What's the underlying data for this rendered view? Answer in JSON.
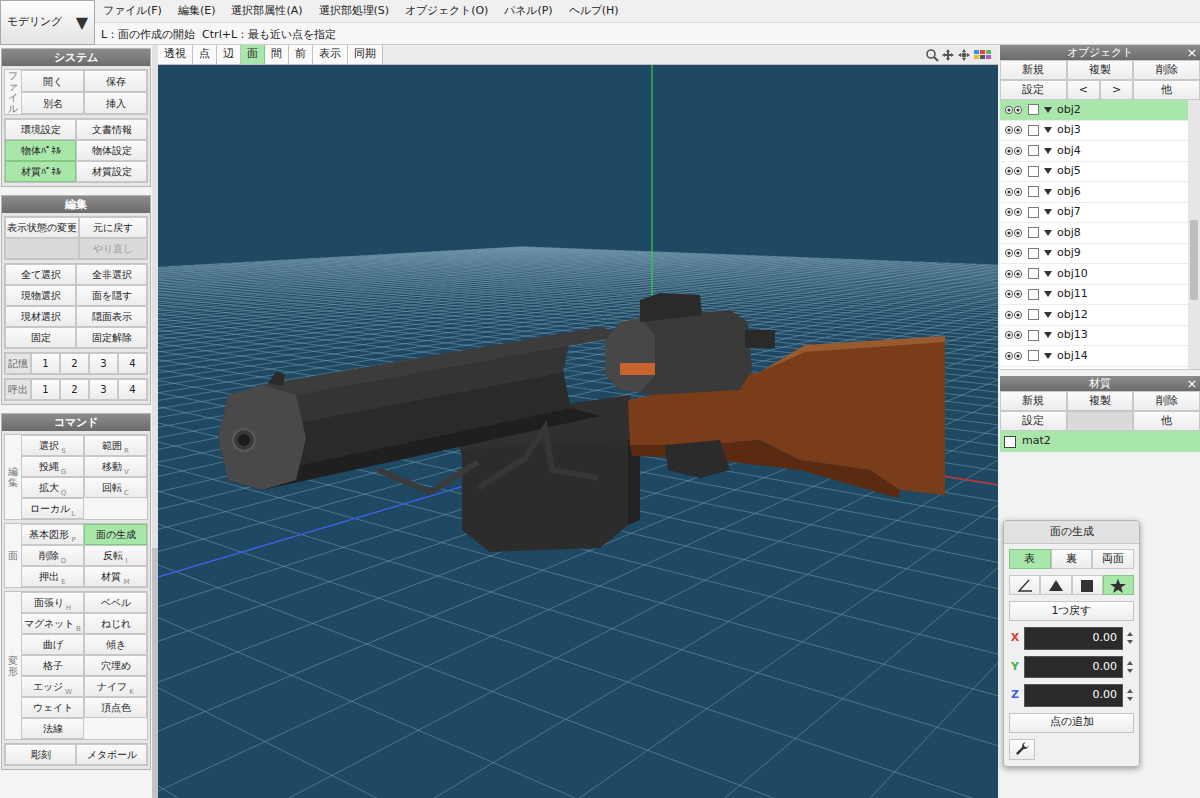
{
  "mode_selector": {
    "label": "モデリング",
    "arrow": "▼"
  },
  "menu": [
    "ファイル(F)",
    "編集(E)",
    "選択部属性(A)",
    "選択部処理(S)",
    "オブジェクト(O)",
    "パネル(P)",
    "ヘルプ(H)"
  ],
  "hint": "L：面の作成の開始  Ctrl+L：最も近い点を指定",
  "left_panel": {
    "sections": [
      {
        "title": "システム",
        "groups": [
          {
            "kind": "stack",
            "label": "ファイル",
            "rows": [
              [
                {
                  "label": "開く",
                  "selected": false,
                  "disabled": false
                },
                {
                  "label": "保存",
                  "selected": false,
                  "disabled": false
                }
              ],
              [
                {
                  "label": "別名",
                  "selected": false,
                  "disabled": false
                },
                {
                  "label": "挿入",
                  "selected": false,
                  "disabled": false
                }
              ]
            ]
          },
          {
            "kind": "plain",
            "rows": [
              [
                {
                  "label": "環境設定",
                  "selected": false,
                  "disabled": false
                },
                {
                  "label": "文書情報",
                  "selected": false,
                  "disabled": false
                }
              ],
              [
                {
                  "label": "物体ﾊﾟﾈﾙ",
                  "selected": true,
                  "disabled": false
                },
                {
                  "label": "物体設定",
                  "selected": false,
                  "disabled": false
                }
              ],
              [
                {
                  "label": "材質ﾊﾟﾈﾙ",
                  "selected": true,
                  "disabled": false
                },
                {
                  "label": "材質設定",
                  "selected": false,
                  "disabled": false
                }
              ]
            ]
          }
        ]
      },
      {
        "title": "編集",
        "groups": [
          {
            "kind": "plain",
            "rows": [
              [
                {
                  "label": "表示状態の変更",
                  "selected": false,
                  "disabled": false
                },
                {
                  "label": "元に戻す",
                  "selected": false,
                  "disabled": false
                }
              ],
              [
                {
                  "label": "",
                  "selected": false,
                  "disabled": true
                },
                {
                  "label": "やり直し",
                  "selected": false,
                  "disabled": true
                }
              ]
            ]
          },
          {
            "kind": "plain",
            "rows": [
              [
                {
                  "label": "全て選択",
                  "selected": false,
                  "disabled": false
                },
                {
                  "label": "全非選択",
                  "selected": false,
                  "disabled": false
                }
              ],
              [
                {
                  "label": "現物選択",
                  "selected": false,
                  "disabled": false
                },
                {
                  "label": "面を隠す",
                  "selected": false,
                  "disabled": false
                }
              ],
              [
                {
                  "label": "現材選択",
                  "selected": false,
                  "disabled": false
                },
                {
                  "label": "隠面表示",
                  "selected": false,
                  "disabled": false
                }
              ],
              [
                {
                  "label": "固定",
                  "selected": false,
                  "disabled": false
                },
                {
                  "label": "固定解除",
                  "selected": false,
                  "disabled": false
                }
              ]
            ]
          },
          {
            "kind": "inline",
            "label": "記憶",
            "rows": [
              [
                {
                  "label": "1",
                  "selected": false,
                  "disabled": false
                },
                {
                  "label": "2",
                  "selected": false,
                  "disabled": false
                },
                {
                  "label": "3",
                  "selected": false,
                  "disabled": false
                },
                {
                  "label": "4",
                  "selected": false,
                  "disabled": false
                }
              ]
            ]
          },
          {
            "kind": "inline",
            "label": "呼出",
            "rows": [
              [
                {
                  "label": "1",
                  "selected": false,
                  "disabled": false
                },
                {
                  "label": "2",
                  "selected": false,
                  "disabled": false
                },
                {
                  "label": "3",
                  "selected": false,
                  "disabled": false
                },
                {
                  "label": "4",
                  "selected": false,
                  "disabled": false
                }
              ]
            ]
          }
        ]
      },
      {
        "title": "コマンド",
        "groups": [
          {
            "kind": "stack",
            "label": "編集",
            "rows": [
              [
                {
                  "label": "選択",
                  "key": "S",
                  "selected": false,
                  "disabled": false
                },
                {
                  "label": "範囲",
                  "key": "R",
                  "selected": false,
                  "disabled": false
                }
              ],
              [
                {
                  "label": "投縄",
                  "key": "G",
                  "selected": false,
                  "disabled": false
                },
                {
                  "label": "移動",
                  "key": "V",
                  "selected": false,
                  "disabled": false
                }
              ],
              [
                {
                  "label": "拡大",
                  "key": "Q",
                  "selected": false,
                  "disabled": false
                },
                {
                  "label": "回転",
                  "key": "C",
                  "selected": false,
                  "disabled": false
                }
              ],
              [
                {
                  "label": "ローカル",
                  "key": "L",
                  "selected": false,
                  "disabled": false
                }
              ]
            ]
          },
          {
            "kind": "stack",
            "label": "面",
            "rows": [
              [
                {
                  "label": "基本図形",
                  "key": "P",
                  "selected": false,
                  "disabled": false
                },
                {
                  "label": "面の生成",
                  "selected": true,
                  "disabled": false
                }
              ],
              [
                {
                  "label": "削除",
                  "key": "D",
                  "selected": false,
                  "disabled": false
                },
                {
                  "label": "反転",
                  "key": "I",
                  "selected": false,
                  "disabled": false
                }
              ],
              [
                {
                  "label": "押出",
                  "key": "E",
                  "selected": false,
                  "disabled": false
                },
                {
                  "label": "材質",
                  "key": "M",
                  "selected": false,
                  "disabled": false
                }
              ]
            ]
          },
          {
            "kind": "stack",
            "label": "変形",
            "rows": [
              [
                {
                  "label": "面張り",
                  "key": "H",
                  "selected": false,
                  "disabled": false
                },
                {
                  "label": "ベベル",
                  "selected": false,
                  "disabled": false
                }
              ],
              [
                {
                  "label": "マグネット",
                  "key": "B",
                  "selected": false,
                  "disabled": false
                },
                {
                  "label": "ねじれ",
                  "selected": false,
                  "disabled": false
                }
              ],
              [
                {
                  "label": "曲げ",
                  "selected": false,
                  "disabled": false
                },
                {
                  "label": "傾き",
                  "selected": false,
                  "disabled": false
                }
              ],
              [
                {
                  "label": "格子",
                  "selected": false,
                  "disabled": false
                },
                {
                  "label": "穴埋め",
                  "selected": false,
                  "disabled": false
                }
              ],
              [
                {
                  "label": "エッジ",
                  "key": "W",
                  "selected": false,
                  "disabled": false
                },
                {
                  "label": "ナイフ",
                  "key": "K",
                  "selected": false,
                  "disabled": false
                }
              ],
              [
                {
                  "label": "ウェイト",
                  "selected": false,
                  "disabled": false
                },
                {
                  "label": "頂点色",
                  "selected": false,
                  "disabled": false
                }
              ],
              [
                {
                  "label": "法線",
                  "selected": false,
                  "disabled": false
                }
              ]
            ]
          },
          {
            "kind": "plain",
            "rows": [
              [
                {
                  "label": "彫刻",
                  "selected": false,
                  "disabled": false
                },
                {
                  "label": "メタボール",
                  "selected": false,
                  "disabled": false
                }
              ]
            ]
          }
        ]
      }
    ]
  },
  "viewport": {
    "toolbar": [
      {
        "label": "透視",
        "selected": false
      },
      {
        "label": "点",
        "selected": false
      },
      {
        "label": "辺",
        "selected": false
      },
      {
        "label": "面",
        "selected": true
      },
      {
        "label": "間",
        "selected": false
      },
      {
        "label": "前",
        "selected": false
      },
      {
        "label": "表示",
        "selected": false
      },
      {
        "label": "同期",
        "selected": false
      }
    ]
  },
  "object_panel": {
    "title": "オブジェクト",
    "close": "×",
    "button_rows": [
      [
        {
          "label": "新規",
          "disabled": false
        },
        {
          "label": "複製",
          "disabled": false
        },
        {
          "label": "削除",
          "disabled": false
        }
      ],
      [
        {
          "label": "設定",
          "disabled": false
        },
        {
          "label": "<",
          "disabled": false
        },
        {
          "label": ">",
          "disabled": false
        },
        {
          "label": "他",
          "disabled": false
        }
      ]
    ],
    "items": [
      {
        "name": "obj2",
        "visible": true,
        "locked": false,
        "expanded": true,
        "selected": true
      },
      {
        "name": "obj3",
        "visible": true,
        "locked": false,
        "expanded": true,
        "selected": false
      },
      {
        "name": "obj4",
        "visible": true,
        "locked": false,
        "expanded": true,
        "selected": false
      },
      {
        "name": "obj5",
        "visible": true,
        "locked": false,
        "expanded": true,
        "selected": false
      },
      {
        "name": "obj6",
        "visible": true,
        "locked": false,
        "expanded": true,
        "selected": false
      },
      {
        "name": "obj7",
        "visible": true,
        "locked": false,
        "expanded": true,
        "selected": false
      },
      {
        "name": "obj8",
        "visible": true,
        "locked": false,
        "expanded": true,
        "selected": false
      },
      {
        "name": "obj9",
        "visible": true,
        "locked": false,
        "expanded": true,
        "selected": false
      },
      {
        "name": "obj10",
        "visible": true,
        "locked": false,
        "expanded": true,
        "selected": false
      },
      {
        "name": "obj11",
        "visible": true,
        "locked": false,
        "expanded": true,
        "selected": false
      },
      {
        "name": "obj12",
        "visible": true,
        "locked": false,
        "expanded": true,
        "selected": false
      },
      {
        "name": "obj13",
        "visible": true,
        "locked": false,
        "expanded": true,
        "selected": false
      },
      {
        "name": "obj14",
        "visible": true,
        "locked": false,
        "expanded": true,
        "selected": false
      }
    ]
  },
  "material_panel": {
    "title": "材質",
    "close": "×",
    "button_rows": [
      [
        {
          "label": "新規",
          "disabled": false
        },
        {
          "label": "複製",
          "disabled": false
        },
        {
          "label": "削除",
          "disabled": false
        }
      ],
      [
        {
          "label": "設定",
          "disabled": false
        },
        {
          "label": "",
          "disabled": true
        },
        {
          "label": "他",
          "disabled": false
        }
      ]
    ],
    "items": [
      {
        "name": "mat2",
        "color": "#ffffff",
        "selected": true
      }
    ]
  },
  "face_panel": {
    "title": "面の生成",
    "sides": [
      {
        "label": "表",
        "selected": true
      },
      {
        "label": "裏",
        "selected": false
      },
      {
        "label": "両面",
        "selected": false
      }
    ],
    "modes": [
      {
        "kind": "angle",
        "selected": false
      },
      {
        "kind": "triangle",
        "selected": false
      },
      {
        "kind": "square",
        "selected": false
      },
      {
        "kind": "star",
        "selected": true
      }
    ],
    "undo": "1つ戻す",
    "coords": [
      {
        "axis": "X",
        "value": "0.00",
        "color": "#e03c3c"
      },
      {
        "axis": "Y",
        "value": "0.00",
        "color": "#3cb44b"
      },
      {
        "axis": "Z",
        "value": "0.00",
        "color": "#3c64dc"
      }
    ],
    "add_point": "点の追加"
  }
}
